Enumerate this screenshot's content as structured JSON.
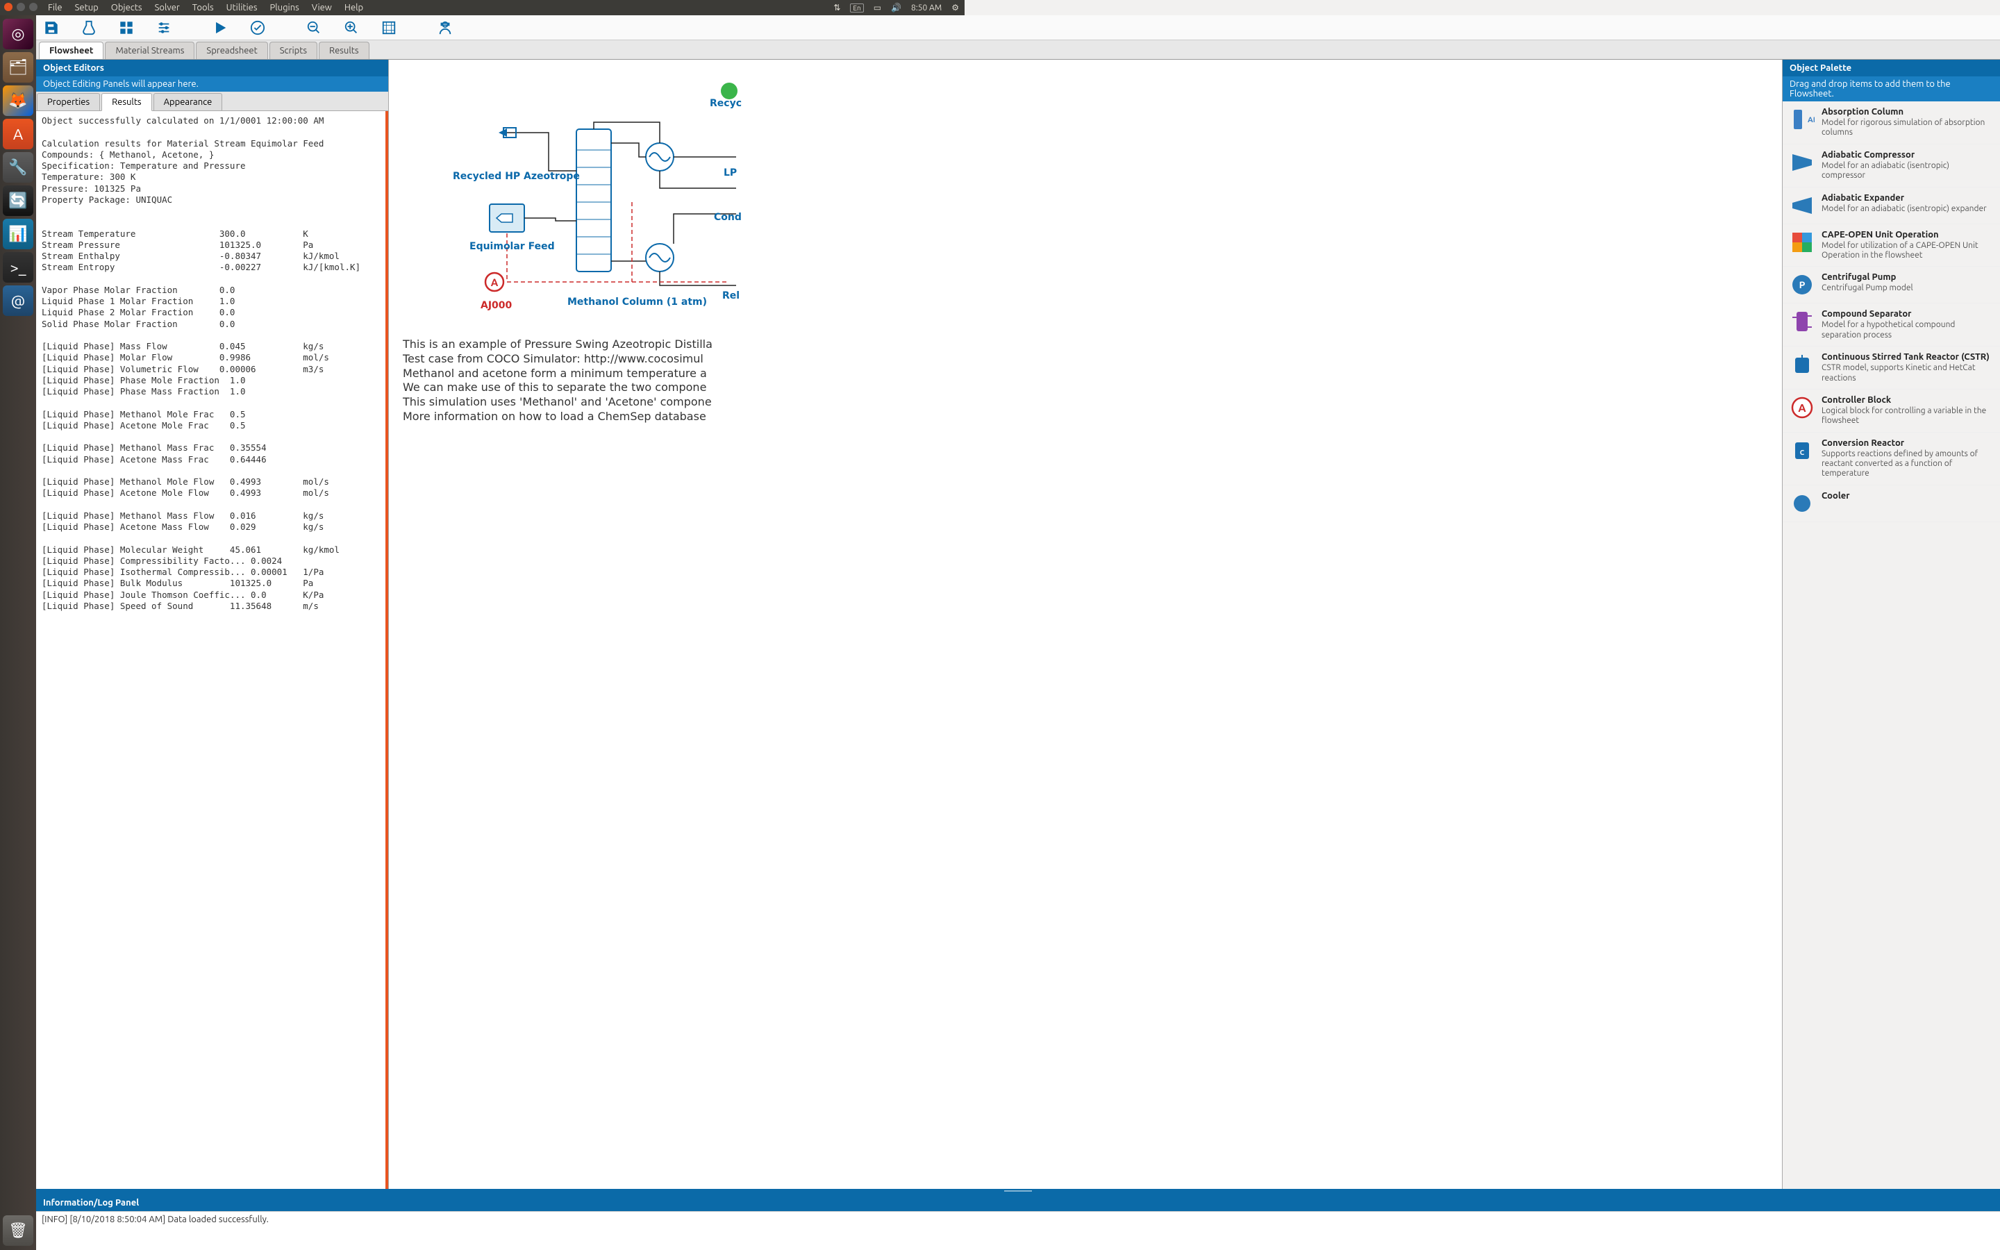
{
  "menubar": {
    "items": [
      "File",
      "Setup",
      "Objects",
      "Solver",
      "Tools",
      "Utilities",
      "Plugins",
      "View",
      "Help"
    ],
    "right": {
      "lang": "En",
      "time": "8:50 AM"
    }
  },
  "dock": {
    "items": [
      "dash",
      "files",
      "firefox",
      "software",
      "settings",
      "updater",
      "dwsim",
      "terminal",
      "remmina"
    ],
    "trash": "trash"
  },
  "toolbar": {
    "buttons": [
      "save",
      "vial",
      "grid",
      "sliders",
      "play",
      "check",
      "zoom-out",
      "zoom-in",
      "fit",
      "inspect"
    ]
  },
  "tabs": {
    "items": [
      "Flowsheet",
      "Material Streams",
      "Spreadsheet",
      "Scripts",
      "Results"
    ],
    "active": 0
  },
  "object_editors": {
    "title": "Object Editors",
    "subtitle": "Object Editing Panels will appear here.",
    "sub_tabs": [
      "Properties",
      "Results",
      "Appearance"
    ],
    "sub_active": 1,
    "results_text": "Object successfully calculated on 1/1/0001 12:00:00 AM\n\nCalculation results for Material Stream Equimolar Feed\nCompounds: { Methanol, Acetone, }\nSpecification: Temperature and Pressure\nTemperature: 300 K\nPressure: 101325 Pa\nProperty Package: UNIQUAC\n\n\nStream Temperature                300.0           K\nStream Pressure                   101325.0        Pa\nStream Enthalpy                   -0.80347        kJ/kmol\nStream Entropy                    -0.00227        kJ/[kmol.K]\n\nVapor Phase Molar Fraction        0.0\nLiquid Phase 1 Molar Fraction     1.0\nLiquid Phase 2 Molar Fraction     0.0\nSolid Phase Molar Fraction        0.0\n\n[Liquid Phase] Mass Flow          0.045           kg/s\n[Liquid Phase] Molar Flow         0.9986          mol/s\n[Liquid Phase] Volumetric Flow    0.00006         m3/s\n[Liquid Phase] Phase Mole Fraction  1.0\n[Liquid Phase] Phase Mass Fraction  1.0\n\n[Liquid Phase] Methanol Mole Frac   0.5\n[Liquid Phase] Acetone Mole Frac    0.5\n\n[Liquid Phase] Methanol Mass Frac   0.35554\n[Liquid Phase] Acetone Mass Frac    0.64446\n\n[Liquid Phase] Methanol Mole Flow   0.4993        mol/s\n[Liquid Phase] Acetone Mole Flow    0.4993        mol/s\n\n[Liquid Phase] Methanol Mass Flow   0.016         kg/s\n[Liquid Phase] Acetone Mass Flow    0.029         kg/s\n\n[Liquid Phase] Molecular Weight     45.061        kg/kmol\n[Liquid Phase] Compressibility Facto... 0.0024\n[Liquid Phase] Isothermal Compressib... 0.00001   1/Pa\n[Liquid Phase] Bulk Modulus         101325.0      Pa\n[Liquid Phase] Joule Thomson Coeffic... 0.0       K/Pa\n[Liquid Phase] Speed of Sound       11.35648      m/s"
  },
  "flowsheet": {
    "labels": {
      "recycled": "Recycled HP Azeotrope",
      "equimolar": "Equimolar Feed",
      "aj000": "AJ000",
      "methanol_col": "Methanol Column (1 atm)",
      "recycle": "Recyc",
      "lp": "LP",
      "cond": "Cond",
      "rel": "Rel"
    },
    "description": [
      "This is an example of Pressure Swing Azeotropic Distilla",
      "Test case from COCO Simulator: http://www.cocosimul",
      "Methanol and acetone form a minimum temperature a",
      "We can make use of this to separate the two compone",
      "This simulation uses 'Methanol' and 'Acetone' compone",
      "More information on how to load a ChemSep database"
    ]
  },
  "palette": {
    "title": "Object Palette",
    "subtitle": "Drag and drop items to add them to the Flowsheet.",
    "items": [
      {
        "title": "Absorption Column",
        "desc": "Model for rigorous simulation of absorption columns",
        "icon": "abs-col"
      },
      {
        "title": "Adiabatic Compressor",
        "desc": "Model for an adiabatic (isentropic) compressor",
        "icon": "compressor"
      },
      {
        "title": "Adiabatic Expander",
        "desc": "Model for an adiabatic (isentropic) expander",
        "icon": "expander"
      },
      {
        "title": "CAPE-OPEN Unit Operation",
        "desc": "Model for utilization of a CAPE-OPEN Unit Operation in the flowsheet",
        "icon": "capeopen"
      },
      {
        "title": "Centrifugal Pump",
        "desc": "Centrifugal Pump model",
        "icon": "pump"
      },
      {
        "title": "Compound Separator",
        "desc": "Model for a hypothetical compound separation process",
        "icon": "separator"
      },
      {
        "title": "Continuous Stirred Tank Reactor (CSTR)",
        "desc": "CSTR model, supports Kinetic and HetCat reactions",
        "icon": "cstr"
      },
      {
        "title": "Controller Block",
        "desc": "Logical block for controlling a variable in the flowsheet",
        "icon": "controller"
      },
      {
        "title": "Conversion Reactor",
        "desc": "Supports reactions defined by amounts of reactant converted as a function of temperature",
        "icon": "convreactor"
      },
      {
        "title": "Cooler",
        "desc": "",
        "icon": "cooler"
      }
    ]
  },
  "log_panel": {
    "title": "Information/Log Panel",
    "line": "[INFO] [8/10/2018 8:50:04 AM] Data loaded successfully."
  }
}
